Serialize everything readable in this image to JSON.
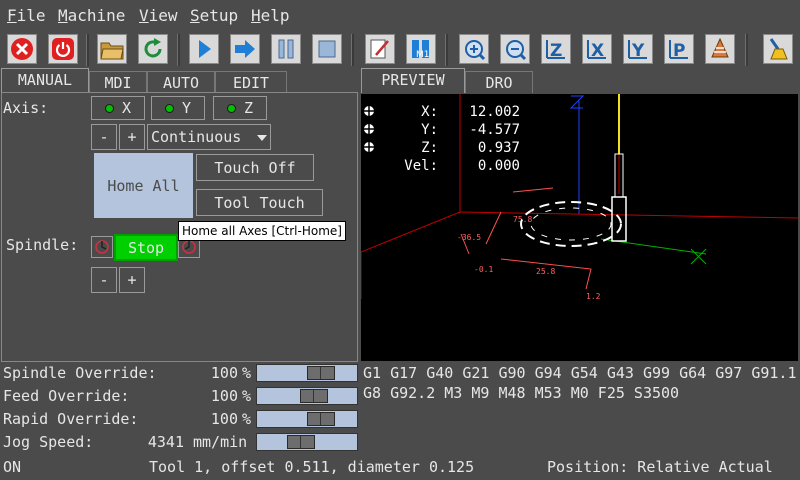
{
  "menubar": {
    "items": [
      {
        "label": "File",
        "mnemonic": "F",
        "rest": "ile"
      },
      {
        "label": "Machine",
        "mnemonic": "M",
        "rest": "achine"
      },
      {
        "label": "View",
        "mnemonic": "V",
        "rest": "iew"
      },
      {
        "label": "Setup",
        "mnemonic": "S",
        "rest": "etup"
      },
      {
        "label": "Help",
        "mnemonic": "H",
        "rest": "elp"
      }
    ]
  },
  "toolbar": {
    "zoom_z": "Z",
    "view_x": "X",
    "view_y": "Y",
    "view_p": "P"
  },
  "left_tabs": [
    "MANUAL",
    "MDI",
    "AUTO",
    "EDIT"
  ],
  "right_tabs": [
    "PREVIEW",
    "DRO"
  ],
  "manual": {
    "axis_label": "Axis:",
    "axes": [
      "X",
      "Y",
      "Z"
    ],
    "jog_minus": "-",
    "jog_plus": "+",
    "jog_mode": "Continuous",
    "home_all": "Home All",
    "touch_off": "Touch Off",
    "tool_touch": "Tool Touch",
    "spindle_label": "Spindle:",
    "spindle_stop": "Stop",
    "spindle_minus": "-",
    "spindle_plus": "+"
  },
  "tooltip": "Home all Axes [Ctrl-Home]",
  "dro": {
    "rows": [
      {
        "label": "X:",
        "value": "12.002"
      },
      {
        "label": "Y:",
        "value": "-4.577"
      },
      {
        "label": "Z:",
        "value": "0.937"
      },
      {
        "label": "Vel:",
        "value": "0.000"
      }
    ]
  },
  "overrides": {
    "spindle": {
      "label": "Spindle Override:",
      "value": "100",
      "unit": "%",
      "level": 0.7
    },
    "feed": {
      "label": "Feed Override:",
      "value": "100",
      "unit": "%",
      "level": 0.6
    },
    "rapid": {
      "label": "Rapid Override:",
      "value": "100",
      "unit": "%",
      "level": 0.7
    },
    "jog": {
      "label": "Jog Speed:",
      "value": "4341",
      "unit": "mm/min",
      "level": 0.42
    }
  },
  "gcodes": {
    "line1": "G1 G17 G40 G21 G90 G94 G54 G43 G99 G64 G97 G91.1",
    "line2": "G8 G92.2 M3 M9 M48 M53 M0 F25 S3500"
  },
  "status": {
    "state": "ON",
    "tool": "Tool 1, offset 0.511, diameter 0.125",
    "position": "Position: Relative Actual"
  },
  "colors": {
    "background": "#4b4b4b",
    "preview_bg": "#000000",
    "stop_green": "#00d000",
    "home_blue": "#b3c4dc",
    "grid_red": "#c00000"
  }
}
